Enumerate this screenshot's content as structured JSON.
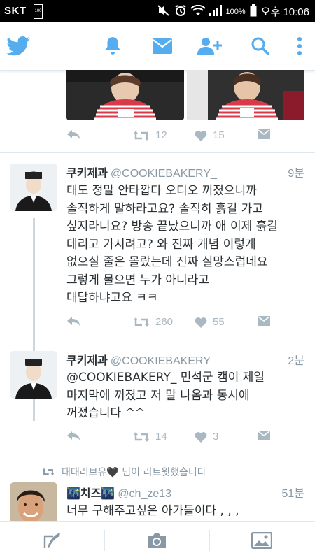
{
  "status_bar": {
    "carrier": "SKT",
    "sim_badge": "100",
    "battery_percent": "100%",
    "time": "오후 10:06"
  },
  "app_bar": {
    "icons": [
      "twitter-bird-icon",
      "notifications-bell-icon",
      "messages-envelope-icon",
      "add-user-icon",
      "search-icon",
      "more-vertical-icon"
    ]
  },
  "colors": {
    "accent": "#55acee",
    "muted": "#aab8c2",
    "text": "#292f33",
    "handle": "#8899a6"
  },
  "tweets": [
    {
      "retweets": "12",
      "likes": "15"
    },
    {
      "name": "쿠키제과",
      "handle": "@COOKIEBAKERY_",
      "time": "9분",
      "text": "태도 정말 안타깝다 오디오 꺼졌으니까\n솔직하게 말하라고요? 솔직히 흙길 가고\n싶지라니요? 방송 끝났으니까 애 이제 흙길\n데리고 가시려고? 와 진짜 개념 이렇게\n없으실 줄은 몰랐는데 진짜 실망스럽네요\n그렇게 물으면 누가 아니라고\n대답하냐고요 ㅋㅋ",
      "retweets": "260",
      "likes": "55"
    },
    {
      "name": "쿠키제과",
      "handle": "@COOKIEBAKERY_",
      "time": "2분",
      "text": "@COOKIEBAKERY_ 민석군 캠이 제일\n마지막에 꺼졌고 저 말 나옴과 동시에\n꺼졌습니다 ^^",
      "retweets": "14",
      "likes": "3"
    },
    {
      "retweeted_by": "태태러브유🖤 님이 리트윗했습니다",
      "name": "🌃치즈🌃",
      "handle": "@ch_ze13",
      "time": "51분",
      "text": "너무 구해주고싶은 아가들이다 , , ,"
    }
  ],
  "bottom_bar": {
    "icons": [
      "compose-tweet-icon",
      "camera-icon",
      "image-icon"
    ]
  }
}
